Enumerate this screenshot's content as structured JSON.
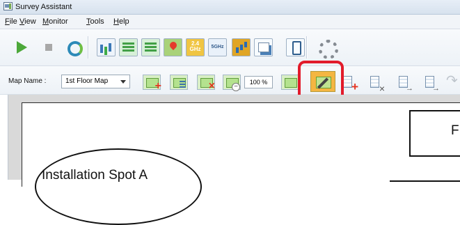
{
  "window": {
    "title": "Survey Assistant"
  },
  "menu": {
    "items": [
      "File",
      "View",
      "Monitor",
      "Tools",
      "Help"
    ]
  },
  "toolbar": {
    "top_icons": [
      "play-icon",
      "stop-icon",
      "refresh-icon",
      "channel-bars-icon",
      "green-bars-icon",
      "green-bars-icon",
      "map-pin-icon",
      "2.4-ghz-icon",
      "5ghz-icon",
      "signal-bars-icon",
      "report-icon",
      "device-icon",
      "gear-icon"
    ],
    "freq_24": "2.4\nGHz",
    "freq_5": "5GHz"
  },
  "map_toolbar": {
    "map_name_label": "Map Name :",
    "map_name_value": "1st Floor Map",
    "zoom_value": "100 %",
    "active_tool": "edit-map"
  },
  "canvas": {
    "installation_label": "Installation Spot A",
    "room_label": "F"
  },
  "colors": {
    "highlight": "#e21b2b",
    "active_tool": "#f4b642"
  }
}
